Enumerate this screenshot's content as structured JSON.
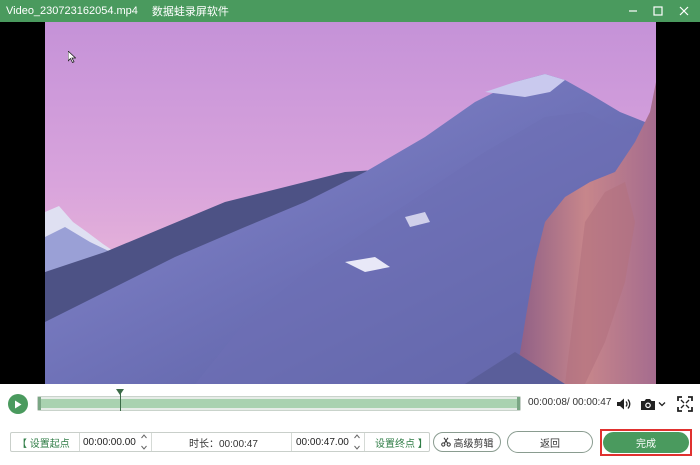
{
  "window": {
    "file_name": "Video_230723162054.mp4",
    "app_name": "数据蛙录屏软件"
  },
  "player": {
    "current_time": "00:00:08",
    "total_time": "00:00:47",
    "time_display": "00:00:08/ 00:00:47",
    "progress_fraction": 0.17
  },
  "trim": {
    "set_start_label": "【 设置起点",
    "start_time": "00:00:00.00",
    "duration_label": "时长：00:00:47",
    "end_time": "00:00:47.00",
    "set_end_label": "设置终点 】"
  },
  "actions": {
    "advanced_edit": "高级剪辑",
    "back": "返回",
    "done": "完成"
  },
  "icons": {
    "play": "play-icon",
    "volume": "volume-icon",
    "camera": "camera-icon",
    "fullscreen": "fullscreen-icon",
    "scissors": "scissors-icon"
  },
  "colors": {
    "accent": "#4a9a5e",
    "highlight_outline": "#e0312f"
  }
}
